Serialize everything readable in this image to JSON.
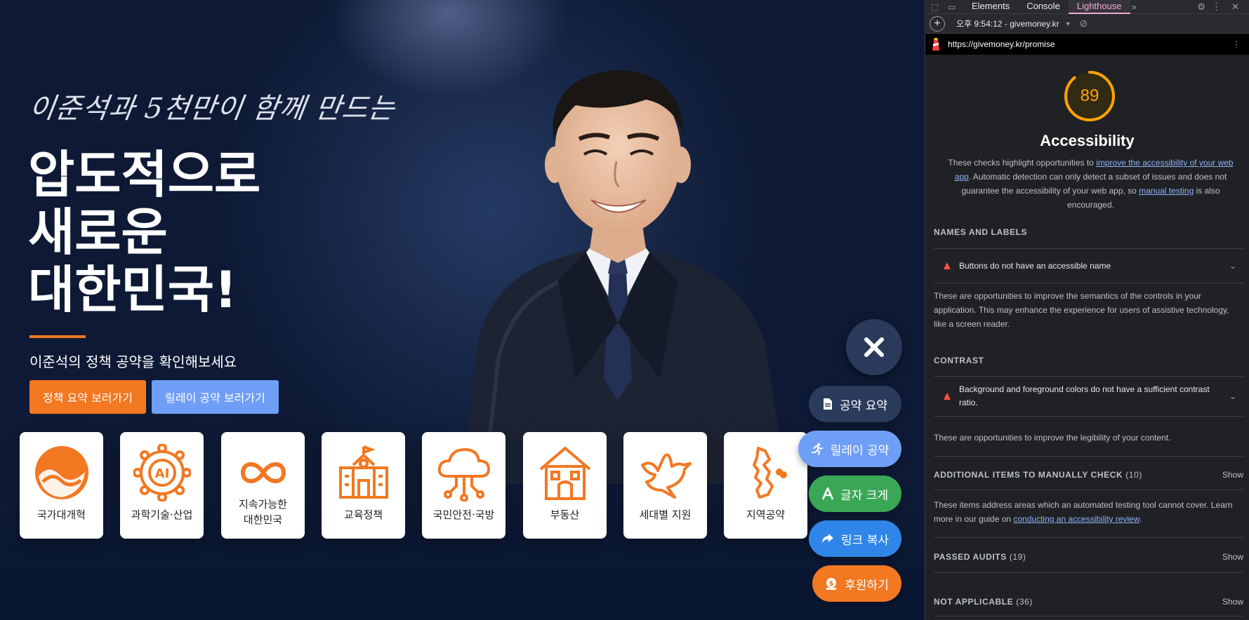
{
  "hero": {
    "script_line": "이준석과 5천만이 함께 만드는",
    "title_lines": [
      "압도적으로",
      "새로운",
      "대한민국!"
    ],
    "subtitle": "이준석의 정책 공약을 확인해보세요",
    "primary_button": "정책 요약 보러가기",
    "secondary_button": "릴레이 공약 보러가기"
  },
  "categories": [
    {
      "label": "국가대개혁",
      "icon": "korea-taeguk-icon"
    },
    {
      "label": "과학기술·산업",
      "icon": "ai-chip-icon"
    },
    {
      "label": "지속가능한\n대한민국",
      "icon": "infinity-icon"
    },
    {
      "label": "교육정책",
      "icon": "school-building-icon"
    },
    {
      "label": "국민안전·국방",
      "icon": "cloud-circuit-icon"
    },
    {
      "label": "부동산",
      "icon": "house-icon"
    },
    {
      "label": "세대별 지원",
      "icon": "dove-icon"
    },
    {
      "label": "지역공약",
      "icon": "korea-map-icon"
    }
  ],
  "floating_menu": {
    "close_icon": "close-icon",
    "items": [
      {
        "label": "공약 요약",
        "icon": "document-icon",
        "color": "#2b3b5c"
      },
      {
        "label": "릴레이 공약",
        "icon": "runner-icon",
        "color": "#6f9ef7"
      },
      {
        "label": "글자 크게",
        "icon": "letter-a-icon",
        "color": "#3aa757"
      },
      {
        "label": "링크 복사",
        "icon": "share-arrow-icon",
        "color": "#2f86e8"
      },
      {
        "label": "후원하기",
        "icon": "donate-icon",
        "color": "#f27822"
      }
    ]
  },
  "devtools": {
    "tabs": [
      "Elements",
      "Console",
      "Lighthouse"
    ],
    "active_tab": "Lighthouse",
    "report_label": "오후 9:54:12 - givemoney.kr",
    "url": "https://givemoney.kr/promise",
    "score": "89",
    "score_color": "#ffa400",
    "category": "Accessibility",
    "description": {
      "before": "These checks highlight opportunities to ",
      "link1": "improve the accessibility of your web app",
      "middle": ". Automatic detection can only detect a subset of issues and does not guarantee the accessibility of your web app, so ",
      "link2": "manual testing",
      "after": " is also encouraged."
    },
    "sections": {
      "names_labels": {
        "title": "NAMES AND LABELS",
        "audit": "Buttons do not have an accessible name",
        "note": "These are opportunities to improve the semantics of the controls in your application. This may enhance the experience for users of assistive technology, like a screen reader."
      },
      "contrast": {
        "title": "CONTRAST",
        "audit": "Background and foreground colors do not have a sufficient contrast ratio.",
        "note": "These are opportunities to improve the legibility of your content."
      },
      "manual": {
        "title": "ADDITIONAL ITEMS TO MANUALLY CHECK",
        "count": "(10)",
        "show": "Show",
        "note_before": "These items address areas which an automated testing tool cannot cover. Learn more in our guide on ",
        "note_link": "conducting an accessibility review",
        "note_after": "."
      },
      "passed": {
        "title": "PASSED AUDITS",
        "count": "(19)",
        "show": "Show"
      },
      "not_applicable": {
        "title": "NOT APPLICABLE",
        "count": "(36)",
        "show": "Show"
      }
    }
  }
}
